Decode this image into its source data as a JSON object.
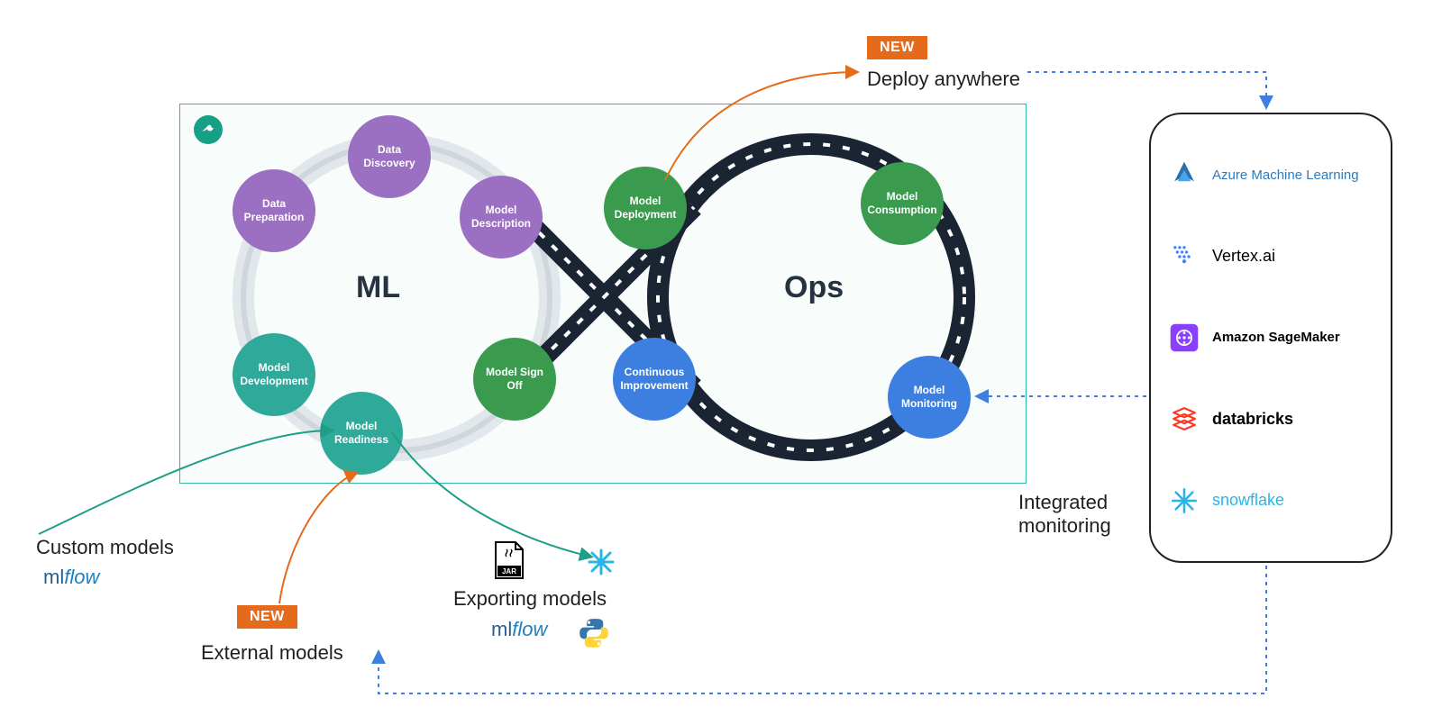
{
  "badges": {
    "new": "NEW"
  },
  "loops": {
    "ml": "ML",
    "ops": "Ops"
  },
  "nodes": {
    "data_discovery": "Data Discovery",
    "data_preparation": "Data Preparation",
    "model_description": "Model Description",
    "model_development": "Model Development",
    "model_readiness": "Model Readiness",
    "model_sign_off": "Model Sign Off",
    "model_deployment": "Model Deployment",
    "model_consumption": "Model Consumption",
    "continuous_improvement": "Continuous Improvement",
    "model_monitoring": "Model Monitoring"
  },
  "callouts": {
    "deploy_anywhere": "Deploy anywhere",
    "custom_models": "Custom models",
    "external_models": "External models",
    "exporting_models": "Exporting models",
    "integrated_monitoring": "Integrated monitoring"
  },
  "brands": {
    "mlflow": "mlflow",
    "jar": "JAR",
    "python": "python",
    "snowflake": "snowflake"
  },
  "platforms": [
    {
      "name": "Azure Machine Learning",
      "key": "azureml"
    },
    {
      "name": "Vertex.ai",
      "key": "vertex"
    },
    {
      "name": "Amazon SageMaker",
      "key": "sagemaker"
    },
    {
      "name": "databricks",
      "key": "databricks"
    },
    {
      "name": "snowflake",
      "key": "snowflake"
    }
  ],
  "colors": {
    "purple": "#9b6fc1",
    "teal": "#2ea99a",
    "green": "#3a9b4f",
    "blue": "#3d7fe0",
    "orange": "#e56a1b",
    "navy": "#1a2433",
    "border_teal": "#2eb9a2",
    "snow_blue": "#29b5e8"
  }
}
